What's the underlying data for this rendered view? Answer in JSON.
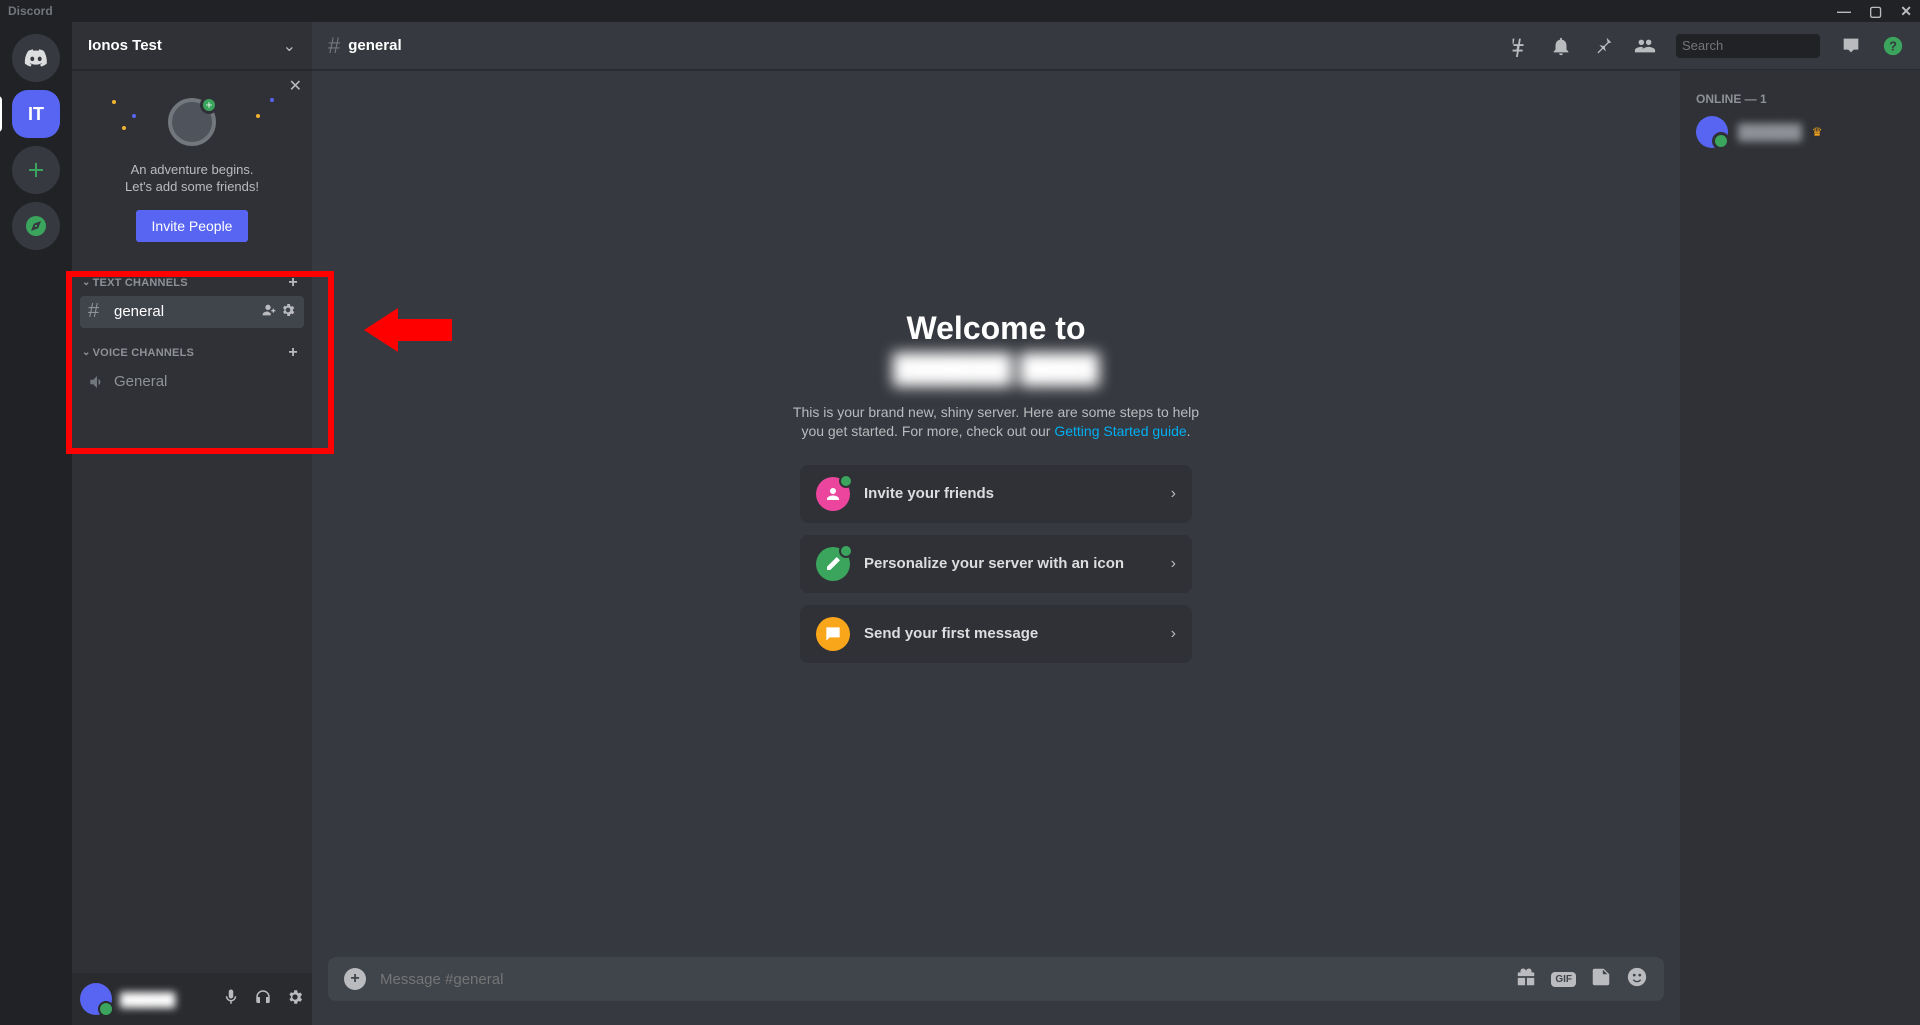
{
  "titlebar": {
    "app_name": "Discord"
  },
  "rail": {
    "server_initials": "IT"
  },
  "sidebar": {
    "server_name": "Ionos Test",
    "invite": {
      "line1": "An adventure begins.",
      "line2": "Let's add some friends!",
      "button": "Invite People"
    },
    "cat_text": "TEXT CHANNELS",
    "cat_voice": "VOICE CHANNELS",
    "text_channel": "general",
    "voice_channel": "General"
  },
  "user_panel": {
    "username": "██████"
  },
  "header": {
    "channel": "general",
    "search_placeholder": "Search"
  },
  "welcome": {
    "title": "Welcome to",
    "server_name": "██████ ████",
    "sub_before": "This is your brand new, shiny server. Here are some steps to help you get started. For more, check out our ",
    "sub_link": "Getting Started guide",
    "card1": "Invite your friends",
    "card2": "Personalize your server with an icon",
    "card3": "Send your first message"
  },
  "composer": {
    "placeholder": "Message #general"
  },
  "members": {
    "header": "ONLINE — 1",
    "name": "██████"
  }
}
